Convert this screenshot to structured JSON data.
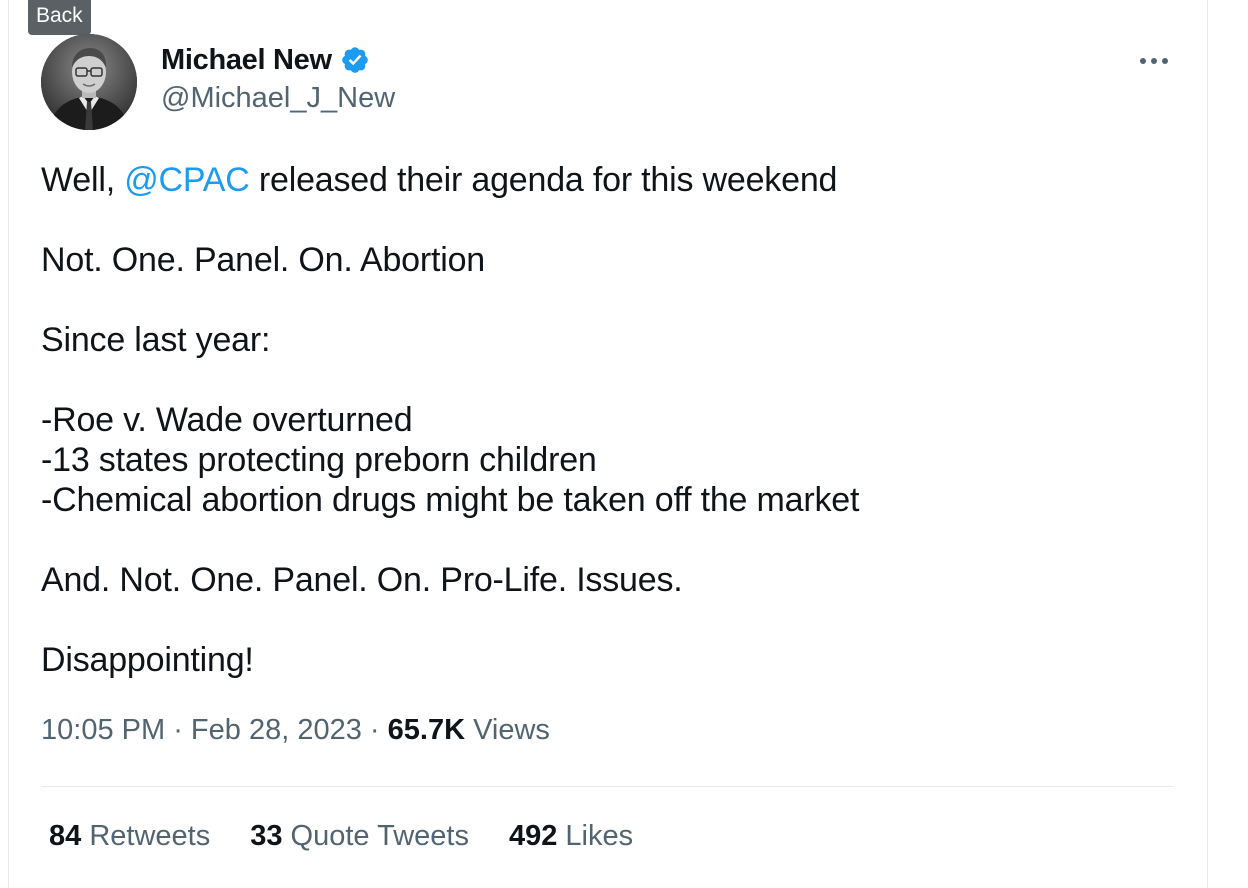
{
  "back_tooltip": "Back",
  "author": {
    "display_name": "Michael New",
    "handle": "@Michael_J_New",
    "verified": true,
    "avatar_icon": "avatar-photo"
  },
  "tweet": {
    "line1_prefix": "Well, ",
    "line1_mention": "@CPAC",
    "line1_suffix": " released their agenda for this weekend",
    "line2": "Not. One. Panel. On. Abortion",
    "line3": "Since last year:",
    "line4": "-Roe v. Wade overturned",
    "line5": "-13 states protecting preborn children",
    "line6": "-Chemical abortion drugs might be taken off the market",
    "line7": "And. Not. One. Panel. On. Pro-Life. Issues.",
    "line8": "Disappointing!"
  },
  "meta": {
    "time": "10:05 PM",
    "separator1": " · ",
    "date": "Feb 28, 2023",
    "separator2": " · ",
    "views_count": "65.7K",
    "views_label": " Views"
  },
  "stats": {
    "retweets": {
      "count": "84",
      "label": " Retweets"
    },
    "quote_tweets": {
      "count": "33",
      "label": " Quote Tweets"
    },
    "likes": {
      "count": "492",
      "label": " Likes"
    }
  },
  "colors": {
    "link": "#1d9bf0",
    "text": "#0f1419",
    "secondary": "#536471",
    "divider": "#e7e9eb"
  }
}
